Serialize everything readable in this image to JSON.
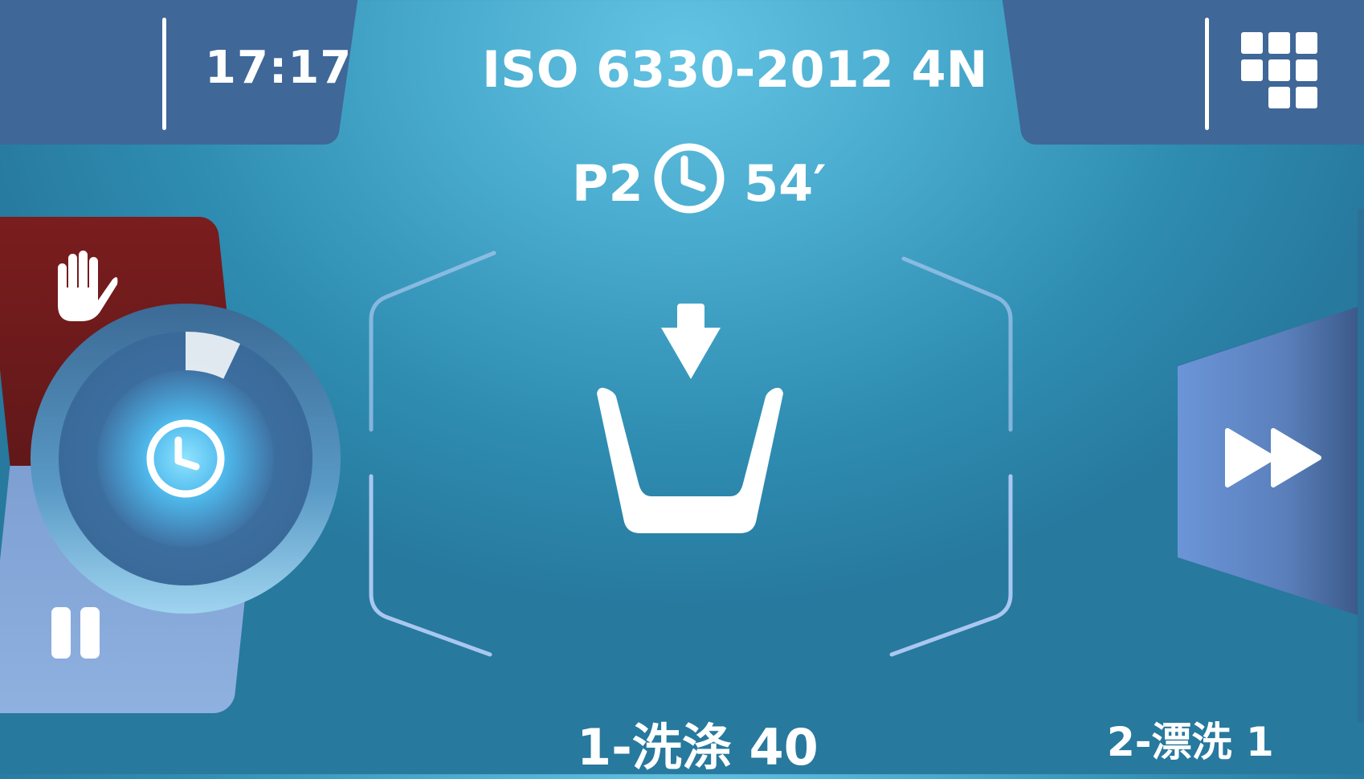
{
  "header": {
    "time": "17:17",
    "title": "ISO 6330-2012 4N",
    "menu_icon": "grid-menu-icon"
  },
  "program": {
    "code": "P2",
    "timer_icon": "clock-icon",
    "remaining": "54′"
  },
  "controls": {
    "stop_icon": "hand-stop-icon",
    "pause_icon": "pause-icon",
    "dial_icon": "clock-icon",
    "skip_icon": "fast-forward-icon",
    "dial_progress": 0.05
  },
  "status": {
    "phase_icon": "detergent-load-icon"
  },
  "steps": {
    "current": "1-洗涤 40",
    "next": "2-漂洗 1"
  },
  "colors": {
    "stop": "#6e1a1b",
    "pause": "#8aaddd",
    "header_tab": "#3f6798",
    "skip": "#6b8fd0"
  }
}
